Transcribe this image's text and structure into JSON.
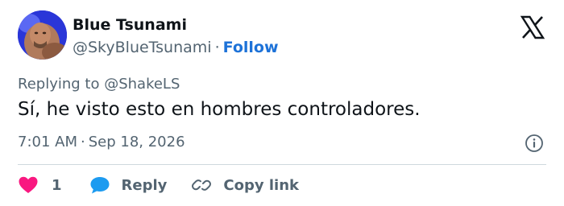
{
  "author": {
    "name": "Blue Tsunami",
    "handle": "@SkyBlueTsunami",
    "separator": "·",
    "follow_label": "Follow"
  },
  "brand": {
    "logo_icon": "x-logo-icon"
  },
  "tweet": {
    "replying_to": "Replying to @ShakeLS",
    "text": "Sí, he visto esto en hombres controladores.",
    "time": "7:01 AM",
    "separator": "·",
    "date": "Sep 18, 2026",
    "info_icon": "info-icon"
  },
  "actions": {
    "like_icon": "heart-icon",
    "like_count": "1",
    "reply_icon": "speech-bubble-icon",
    "reply_label": "Reply",
    "copy_icon": "link-icon",
    "copy_label": "Copy link"
  },
  "colors": {
    "follow": "#1d72d8",
    "heart": "#f91880",
    "reply_bubble": "#1d9bf0",
    "secondary_text": "#536471",
    "primary_text": "#0f1419"
  }
}
